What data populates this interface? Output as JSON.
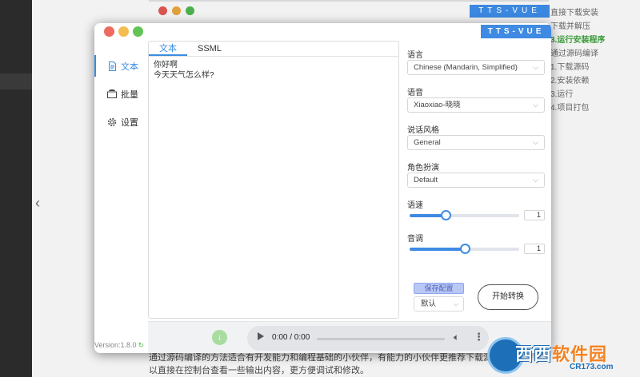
{
  "background": {
    "banner": "TTS-VUE",
    "steps": [
      "直接下载安装",
      "下载并解压",
      "3.运行安装程序",
      "通过源码编译",
      "1.下载源码",
      "2.安装依赖",
      "3.运行",
      "4.项目打包"
    ],
    "footer_lines": [
      "通过源码编译的方法适合有开发能力和编程基础的小伙伴，有能力的小伙伴更推荐下载源码",
      "以直接在控制台查看一些输出内容，更方便调试和修改。"
    ]
  },
  "window": {
    "brand": "TTS-VUE",
    "sidebar": {
      "items": [
        {
          "icon": "document-icon",
          "label": "文本"
        },
        {
          "icon": "batch-icon",
          "label": "批量"
        },
        {
          "icon": "gear-icon",
          "label": "设置"
        }
      ],
      "version": "Version:1.8.0"
    },
    "editor": {
      "tabs": [
        {
          "label": "文本"
        },
        {
          "label": "SSML"
        }
      ],
      "lines": [
        "你好啊",
        "今天天气怎么样?"
      ]
    },
    "settings": {
      "language": {
        "label": "语言",
        "value": "Chinese (Mandarin, Simplified)"
      },
      "voice": {
        "label": "语音",
        "value": "Xiaoxiao-晓晓"
      },
      "style": {
        "label": "说话风格",
        "value": "General"
      },
      "role": {
        "label": "角色扮演",
        "value": "Default"
      },
      "rate": {
        "label": "语速",
        "value": "1",
        "position": 0.33
      },
      "pitch": {
        "label": "音调",
        "value": "1",
        "position": 0.5
      },
      "save_config": "保存配置",
      "preset": "默认",
      "start": "开始转换"
    },
    "player": {
      "time": "0:00 / 0:00"
    }
  },
  "watermark": {
    "cn_blue": "西西",
    "cn_orange": "软件园",
    "en": "CR173.com"
  },
  "colors": {
    "accent": "#3f8ae2",
    "window_bg": "#ffffff",
    "traffic_red": "#ee6a5f",
    "traffic_yellow": "#f5bd4f",
    "traffic_green": "#61c454"
  }
}
